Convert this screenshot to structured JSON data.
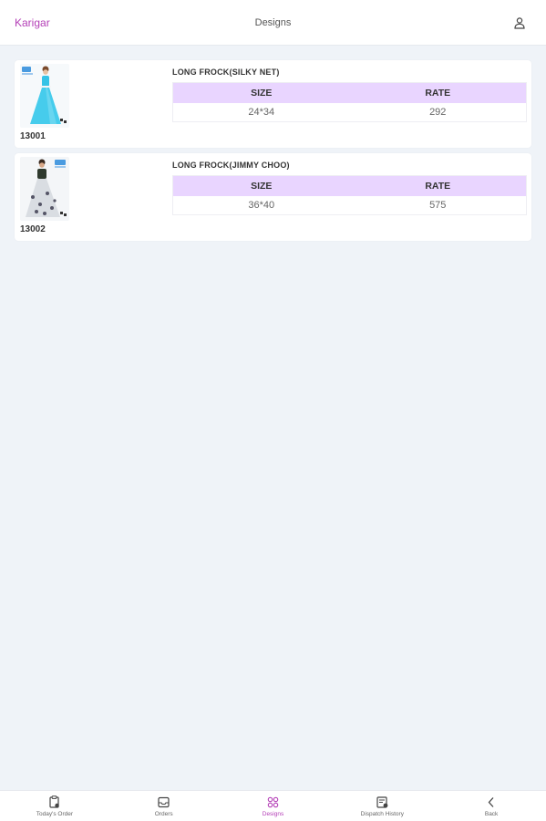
{
  "header": {
    "brand": "Karigar",
    "title": "Designs",
    "user_icon": "user-icon"
  },
  "colors": {
    "accent": "#b43fb7",
    "table_header": "#e9d5ff",
    "background": "#eff3f8"
  },
  "designs": [
    {
      "code": "13001",
      "name": "LONG FROCK(SILKY NET)",
      "headers": {
        "size": "SIZE",
        "rate": "RATE"
      },
      "size": "24*34",
      "rate": "292"
    },
    {
      "code": "13002",
      "name": "LONG FROCK(JIMMY CHOO)",
      "headers": {
        "size": "SIZE",
        "rate": "RATE"
      },
      "size": "36*40",
      "rate": "575"
    }
  ],
  "nav": [
    {
      "label": "Today's Order",
      "icon": "clipboard-icon",
      "active": false
    },
    {
      "label": "Orders",
      "icon": "inbox-icon",
      "active": false
    },
    {
      "label": "Designs",
      "icon": "grid-icon",
      "active": true
    },
    {
      "label": "Dispatch History",
      "icon": "history-icon",
      "active": false
    },
    {
      "label": "Back",
      "icon": "chevron-left-icon",
      "active": false
    }
  ]
}
